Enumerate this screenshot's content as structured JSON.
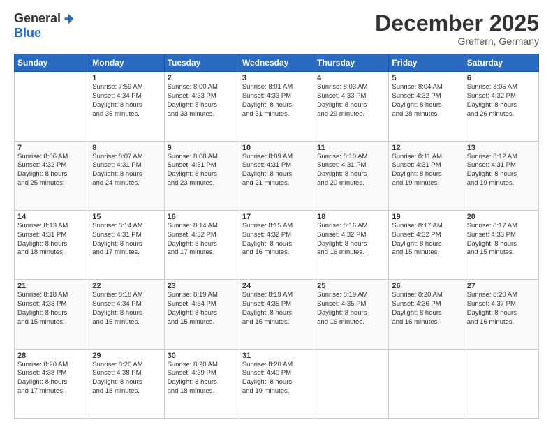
{
  "logo": {
    "general": "General",
    "blue": "Blue"
  },
  "header": {
    "month": "December 2025",
    "location": "Greffern, Germany"
  },
  "days_of_week": [
    "Sunday",
    "Monday",
    "Tuesday",
    "Wednesday",
    "Thursday",
    "Friday",
    "Saturday"
  ],
  "weeks": [
    [
      {
        "day": "",
        "info": ""
      },
      {
        "day": "1",
        "info": "Sunrise: 7:59 AM\nSunset: 4:34 PM\nDaylight: 8 hours\nand 35 minutes."
      },
      {
        "day": "2",
        "info": "Sunrise: 8:00 AM\nSunset: 4:33 PM\nDaylight: 8 hours\nand 33 minutes."
      },
      {
        "day": "3",
        "info": "Sunrise: 8:01 AM\nSunset: 4:33 PM\nDaylight: 8 hours\nand 31 minutes."
      },
      {
        "day": "4",
        "info": "Sunrise: 8:03 AM\nSunset: 4:33 PM\nDaylight: 8 hours\nand 29 minutes."
      },
      {
        "day": "5",
        "info": "Sunrise: 8:04 AM\nSunset: 4:32 PM\nDaylight: 8 hours\nand 28 minutes."
      },
      {
        "day": "6",
        "info": "Sunrise: 8:05 AM\nSunset: 4:32 PM\nDaylight: 8 hours\nand 26 minutes."
      }
    ],
    [
      {
        "day": "7",
        "info": "Sunrise: 8:06 AM\nSunset: 4:32 PM\nDaylight: 8 hours\nand 25 minutes."
      },
      {
        "day": "8",
        "info": "Sunrise: 8:07 AM\nSunset: 4:31 PM\nDaylight: 8 hours\nand 24 minutes."
      },
      {
        "day": "9",
        "info": "Sunrise: 8:08 AM\nSunset: 4:31 PM\nDaylight: 8 hours\nand 23 minutes."
      },
      {
        "day": "10",
        "info": "Sunrise: 8:09 AM\nSunset: 4:31 PM\nDaylight: 8 hours\nand 21 minutes."
      },
      {
        "day": "11",
        "info": "Sunrise: 8:10 AM\nSunset: 4:31 PM\nDaylight: 8 hours\nand 20 minutes."
      },
      {
        "day": "12",
        "info": "Sunrise: 8:11 AM\nSunset: 4:31 PM\nDaylight: 8 hours\nand 19 minutes."
      },
      {
        "day": "13",
        "info": "Sunrise: 8:12 AM\nSunset: 4:31 PM\nDaylight: 8 hours\nand 19 minutes."
      }
    ],
    [
      {
        "day": "14",
        "info": "Sunrise: 8:13 AM\nSunset: 4:31 PM\nDaylight: 8 hours\nand 18 minutes."
      },
      {
        "day": "15",
        "info": "Sunrise: 8:14 AM\nSunset: 4:31 PM\nDaylight: 8 hours\nand 17 minutes."
      },
      {
        "day": "16",
        "info": "Sunrise: 8:14 AM\nSunset: 4:32 PM\nDaylight: 8 hours\nand 17 minutes."
      },
      {
        "day": "17",
        "info": "Sunrise: 8:15 AM\nSunset: 4:32 PM\nDaylight: 8 hours\nand 16 minutes."
      },
      {
        "day": "18",
        "info": "Sunrise: 8:16 AM\nSunset: 4:32 PM\nDaylight: 8 hours\nand 16 minutes."
      },
      {
        "day": "19",
        "info": "Sunrise: 8:17 AM\nSunset: 4:32 PM\nDaylight: 8 hours\nand 15 minutes."
      },
      {
        "day": "20",
        "info": "Sunrise: 8:17 AM\nSunset: 4:33 PM\nDaylight: 8 hours\nand 15 minutes."
      }
    ],
    [
      {
        "day": "21",
        "info": "Sunrise: 8:18 AM\nSunset: 4:33 PM\nDaylight: 8 hours\nand 15 minutes."
      },
      {
        "day": "22",
        "info": "Sunrise: 8:18 AM\nSunset: 4:34 PM\nDaylight: 8 hours\nand 15 minutes."
      },
      {
        "day": "23",
        "info": "Sunrise: 8:19 AM\nSunset: 4:34 PM\nDaylight: 8 hours\nand 15 minutes."
      },
      {
        "day": "24",
        "info": "Sunrise: 8:19 AM\nSunset: 4:35 PM\nDaylight: 8 hours\nand 15 minutes."
      },
      {
        "day": "25",
        "info": "Sunrise: 8:19 AM\nSunset: 4:35 PM\nDaylight: 8 hours\nand 16 minutes."
      },
      {
        "day": "26",
        "info": "Sunrise: 8:20 AM\nSunset: 4:36 PM\nDaylight: 8 hours\nand 16 minutes."
      },
      {
        "day": "27",
        "info": "Sunrise: 8:20 AM\nSunset: 4:37 PM\nDaylight: 8 hours\nand 16 minutes."
      }
    ],
    [
      {
        "day": "28",
        "info": "Sunrise: 8:20 AM\nSunset: 4:38 PM\nDaylight: 8 hours\nand 17 minutes."
      },
      {
        "day": "29",
        "info": "Sunrise: 8:20 AM\nSunset: 4:38 PM\nDaylight: 8 hours\nand 18 minutes."
      },
      {
        "day": "30",
        "info": "Sunrise: 8:20 AM\nSunset: 4:39 PM\nDaylight: 8 hours\nand 18 minutes."
      },
      {
        "day": "31",
        "info": "Sunrise: 8:20 AM\nSunset: 4:40 PM\nDaylight: 8 hours\nand 19 minutes."
      },
      {
        "day": "",
        "info": ""
      },
      {
        "day": "",
        "info": ""
      },
      {
        "day": "",
        "info": ""
      }
    ]
  ]
}
